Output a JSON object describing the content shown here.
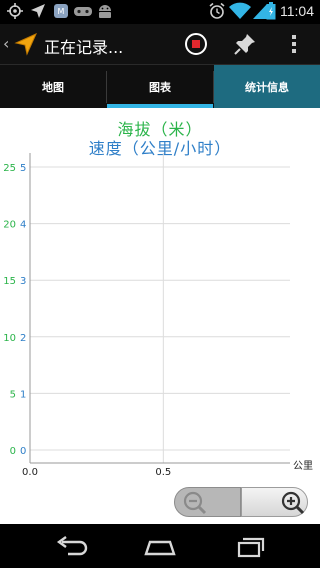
{
  "status_bar": {
    "time": "11:04",
    "icons": [
      "gps-icon",
      "location-arrow-icon",
      "news-icon",
      "gamepad-icon",
      "android-icon",
      "alarm-icon",
      "wifi-icon",
      "cell-signal-icon",
      "battery-icon"
    ]
  },
  "action_bar": {
    "title": "正在记录...",
    "app_icon": "arrow-navigation-icon",
    "actions": [
      "stop-recording-icon",
      "pin-icon",
      "overflow-menu-icon"
    ]
  },
  "tabs": [
    {
      "label": "地图",
      "selected": false
    },
    {
      "label": "图表",
      "selected": true
    },
    {
      "label": "统计信息",
      "selected": false
    }
  ],
  "chart_data": {
    "type": "line",
    "title": "海拔（米）",
    "subtitle": "速度（公里/小时）",
    "xlabel": "公里",
    "x_ticks": [
      "0.0",
      "0.5"
    ],
    "xlim": [
      0.0,
      0.5
    ],
    "y_ticks_left": [
      "25",
      "20",
      "15",
      "10",
      "5",
      "0"
    ],
    "y_ticks_right": [
      "5",
      "4",
      "3",
      "2",
      "1",
      "0"
    ],
    "ylim_left": [
      0,
      25
    ],
    "ylim_right": [
      0,
      5
    ],
    "series": [],
    "grid": true,
    "colors": {
      "elevation": "#2bb44a",
      "speed": "#2f7fc8"
    }
  },
  "zoom": {
    "out_icon": "zoom-out-icon",
    "in_icon": "zoom-in-icon",
    "out_enabled": false
  },
  "nav_bar": {
    "buttons": [
      "back-icon",
      "home-icon",
      "recent-apps-icon"
    ]
  },
  "colors": {
    "accent": "#33b5e5",
    "stats_tab": "#1e6b80"
  }
}
